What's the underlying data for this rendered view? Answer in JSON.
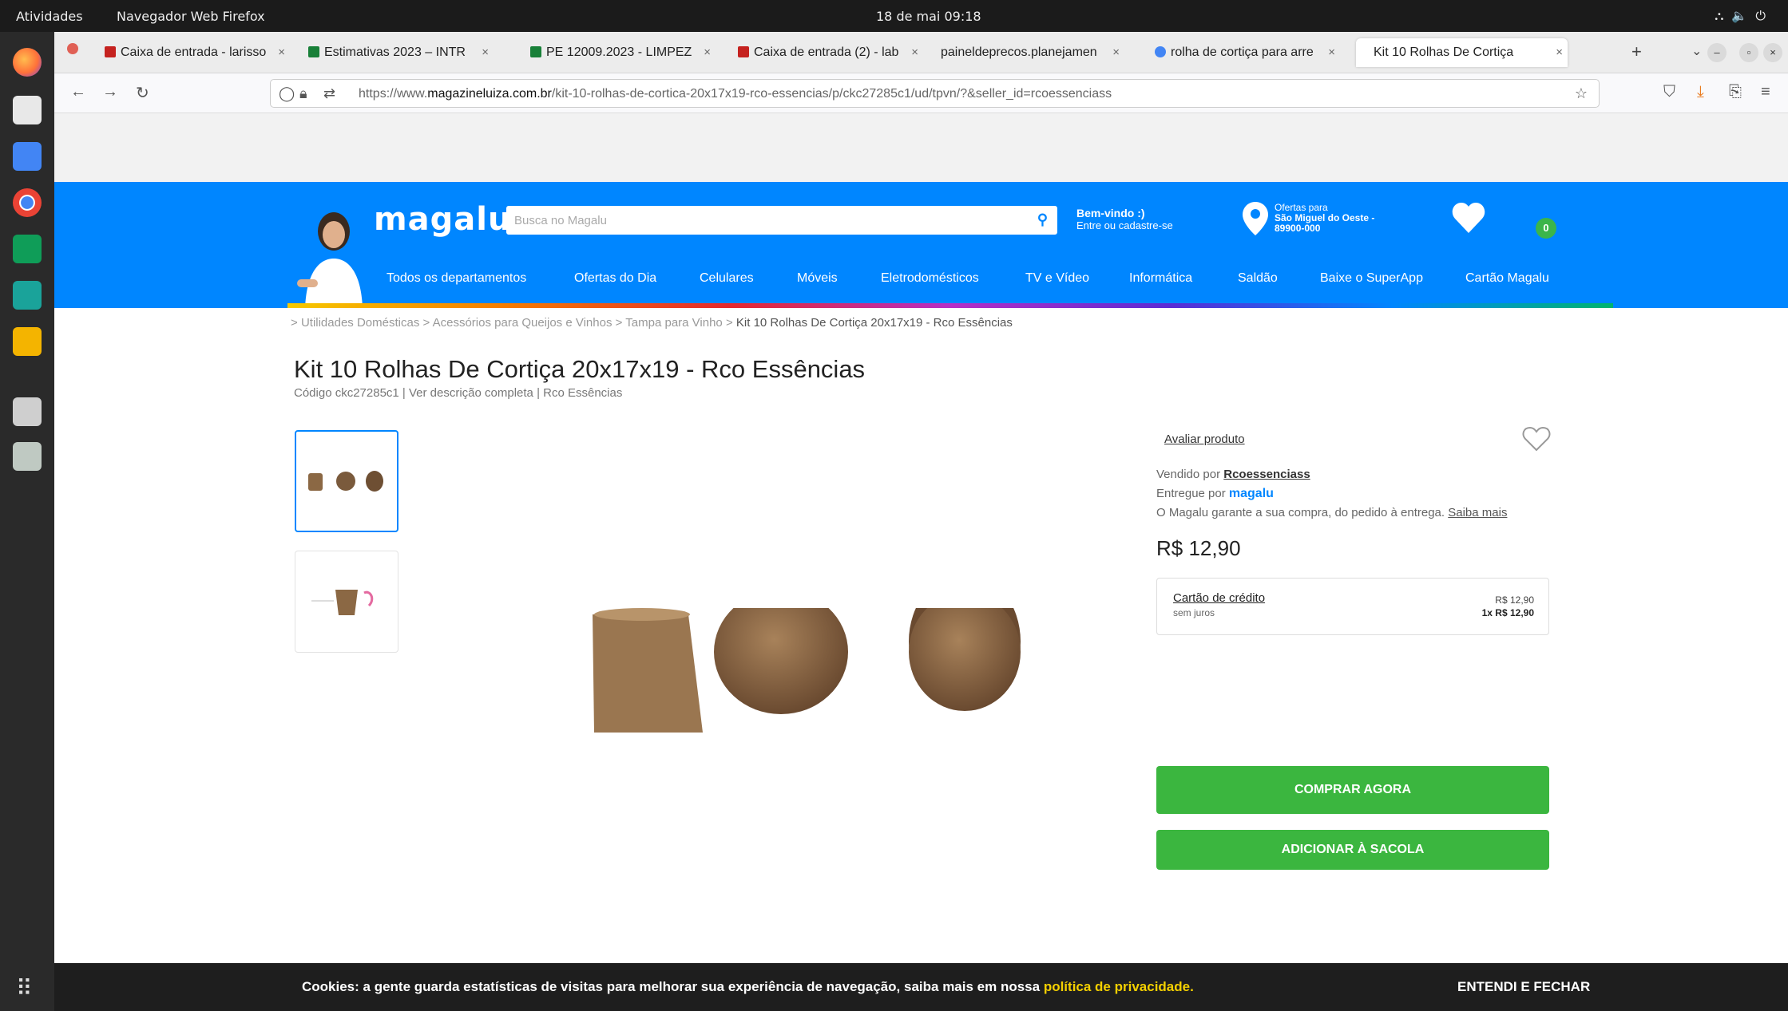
{
  "system": {
    "activities": "Atividades",
    "app_name": "Navegador Web Firefox",
    "clock": "18 de mai  09:18"
  },
  "browser": {
    "tabs": [
      {
        "label": "Caixa de entrada - larisso",
        "color": "#c5221f"
      },
      {
        "label": "Estimativas 2023 – INTR",
        "color": "#188038"
      },
      {
        "label": "PE 12009.2023 - LIMPEZ",
        "color": "#188038"
      },
      {
        "label": "Caixa de entrada (2) - lab",
        "color": "#c5221f"
      },
      {
        "label": "paineldeprecos.planejamen",
        "color": "#888888"
      },
      {
        "label": "rolha de cortiça para arre",
        "color": "#4285f4"
      },
      {
        "label": "Kit 10 Rolhas De Cortiça",
        "color": "#0086ff"
      }
    ],
    "url_prefix": "https://www.",
    "url_domain": "magazineluiza.com.br",
    "url_path": "/kit-10-rolhas-de-cortica-20x17x19-rco-essencias/p/ckc27285c1/ud/tpvn/?&seller_id=rcoessenciass"
  },
  "header": {
    "logo": "magalu",
    "search_placeholder": "Busca no Magalu",
    "welcome_title": "Bem-vindo :)",
    "welcome_sub": "Entre ou cadastre-se",
    "offers_title": "Ofertas para",
    "offers_city": "São Miguel do Oeste -",
    "offers_cep": "89900-000",
    "cart_count": "0",
    "brand_color": "#0086ff",
    "categories": [
      "Todos os departamentos",
      "Ofertas do Dia",
      "Celulares",
      "Móveis",
      "Eletrodomésticos",
      "TV e Vídeo",
      "Informática",
      "Saldão",
      "Baixe o SuperApp",
      "Cartão Magalu"
    ]
  },
  "breadcrumb": {
    "items": [
      "Utilidades Domésticas",
      "Acessórios para Queijos e Vinhos",
      "Tampa para Vinho"
    ],
    "current": "Kit 10 Rolhas De Cortiça 20x17x19 - Rco Essências"
  },
  "product": {
    "title": "Kit 10 Rolhas De Cortiça 20x17x19 - Rco Essências",
    "meta": "Código ckc27285c1 | Ver descrição completa | Rco Essências",
    "rate_label": "Avaliar produto",
    "sold_by_prefix": "Vendido por",
    "seller": "Rcoessenciass",
    "delivered_by_prefix": "Entregue por",
    "delivered_by": "magalu",
    "guarantee": "O Magalu garante a sua compra, do pedido à entrega.",
    "learn_more": "Saiba mais",
    "price": "R$ 12,90",
    "payment_label": "Cartão de crédito",
    "payment_sub": "sem juros",
    "payment_price": "R$ 12,90",
    "payment_installments": "1x R$ 12,90",
    "buy_now": "COMPRAR AGORA",
    "add_to_bag": "ADICIONAR À SACOLA",
    "buy_color": "#3bb63f"
  },
  "cookies": {
    "text": "Cookies: a gente guarda estatísticas de visitas para melhorar sua experiência de navegação, saiba mais em nossa ",
    "link": "política de privacidade.",
    "button": "ENTENDI E FECHAR"
  }
}
